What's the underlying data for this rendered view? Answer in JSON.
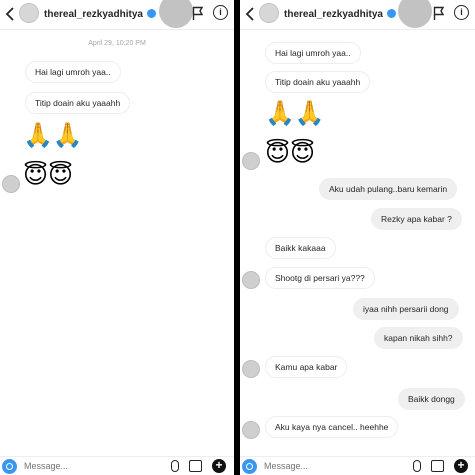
{
  "left": {
    "header": {
      "username": "thereal_rezkyadhitya"
    },
    "timestamp": "April 29, 10:20 PM",
    "messages": [
      {
        "text": "Hai lagi umroh yaa.."
      },
      {
        "text": "Titip doain aku yaaahh"
      }
    ],
    "emoji_row1": "🙏🙏",
    "emoji_row2": "😇😇",
    "composer": {
      "placeholder": "Message..."
    }
  },
  "right": {
    "header": {
      "username": "thereal_rezkyadhitya"
    },
    "messages": [
      {
        "text": "Hai lagi umroh yaa.."
      },
      {
        "text": "Titip doain aku yaaahh"
      },
      {
        "text": "Aku udah pulang..baru kemarin"
      },
      {
        "text": "Rezky apa kabar ?"
      },
      {
        "text": "Baikk kakaaa"
      },
      {
        "text": "Shootg di persari ya???"
      },
      {
        "text": "iyaa nihh persarii dong"
      },
      {
        "text": "kapan nikah sihh?"
      },
      {
        "text": "Kamu  apa kabar"
      },
      {
        "text": "Baikk dongg"
      },
      {
        "text": "Aku kaya nya cancel.. heehhe"
      }
    ],
    "emoji_row1": "🙏🙏",
    "emoji_row2": "😇😇",
    "composer": {
      "placeholder": "Message..."
    }
  },
  "icons": [
    "back-icon",
    "verified-icon",
    "flag-icon",
    "info-icon",
    "camera-icon",
    "mic-icon",
    "gallery-icon",
    "plus-icon"
  ],
  "colors": {
    "accent": "#3897f0",
    "bubble_out": "#efefef",
    "bubble_in_border": "#ededed"
  }
}
